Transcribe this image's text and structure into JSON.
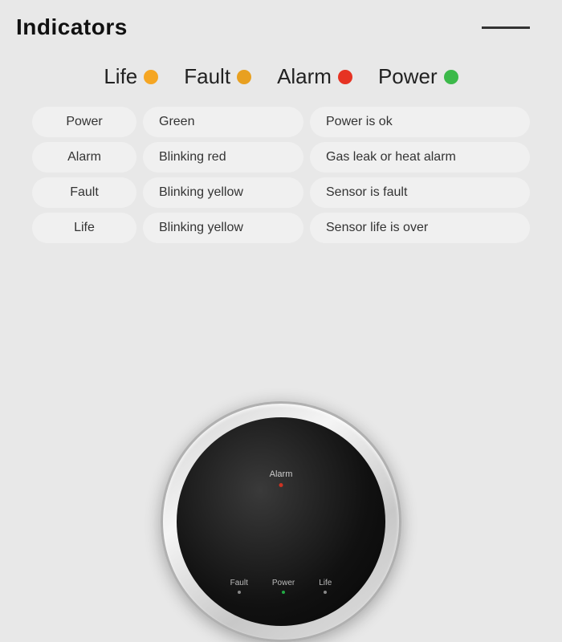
{
  "header": {
    "title": "Indicators",
    "line": true
  },
  "legend": {
    "items": [
      {
        "label": "Life",
        "color": "orange",
        "hex": "#f5a623"
      },
      {
        "label": "Fault",
        "color": "orange2",
        "hex": "#e8a020"
      },
      {
        "label": "Alarm",
        "color": "red",
        "hex": "#e63323"
      },
      {
        "label": "Power",
        "color": "green",
        "hex": "#3cb94a"
      }
    ]
  },
  "table": {
    "rows": [
      {
        "name": "Power",
        "indicator": "Green",
        "description": "Power is ok"
      },
      {
        "name": "Alarm",
        "indicator": "Blinking red",
        "description": "Gas leak or heat alarm"
      },
      {
        "name": "Fault",
        "indicator": "Blinking yellow",
        "description": "Sensor is fault"
      },
      {
        "name": "Life",
        "indicator": "Blinking yellow",
        "description": "Sensor life is over"
      }
    ]
  },
  "device": {
    "alarm_label": "Alarm",
    "bottom_labels": [
      "Fault",
      "Power",
      "Life"
    ]
  }
}
